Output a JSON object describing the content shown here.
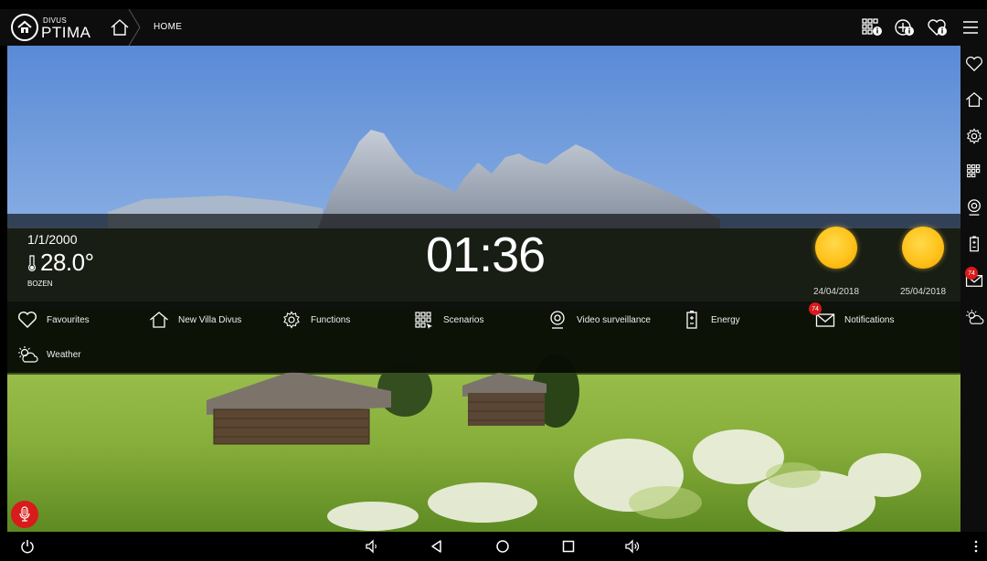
{
  "app": {
    "logo_small": "DIVUS",
    "logo_big": "PTIMA",
    "breadcrumb": "HOME"
  },
  "top_icons": [
    "scenarios-info-icon",
    "add-info-icon",
    "favourite-info-icon",
    "menu-icon"
  ],
  "right_sidebar": {
    "items": [
      {
        "icon": "heart-icon",
        "name": "sidebar-item-favourites"
      },
      {
        "icon": "home-icon",
        "name": "sidebar-item-home"
      },
      {
        "icon": "gear-icon",
        "name": "sidebar-item-functions"
      },
      {
        "icon": "scenarios-icon",
        "name": "sidebar-item-scenarios"
      },
      {
        "icon": "camera-pin-icon",
        "name": "sidebar-item-video-surveillance"
      },
      {
        "icon": "battery-icon",
        "name": "sidebar-item-energy"
      },
      {
        "icon": "envelope-icon",
        "name": "sidebar-item-notifications",
        "badge": "74"
      },
      {
        "icon": "weather-icon",
        "name": "sidebar-item-weather"
      }
    ]
  },
  "status": {
    "date": "1/1/2000",
    "temperature": "28.0°",
    "city": "BOZEN",
    "clock": "01:36"
  },
  "forecast": [
    {
      "date": "24/04/2018",
      "icon": "sun-icon"
    },
    {
      "date": "25/04/2018",
      "icon": "sun-icon"
    }
  ],
  "menu": {
    "favourites": "Favourites",
    "villa": "New Villa Divus",
    "functions": "Functions",
    "scenarios": "Scenarios",
    "video": "Video surveillance",
    "energy": "Energy",
    "notifications": "Notifications",
    "notifications_badge": "74",
    "weather": "Weather"
  },
  "colors": {
    "accent_red": "#d81b1b",
    "sun": "#ffc21a",
    "bar_bg": "#0d0d0d"
  }
}
